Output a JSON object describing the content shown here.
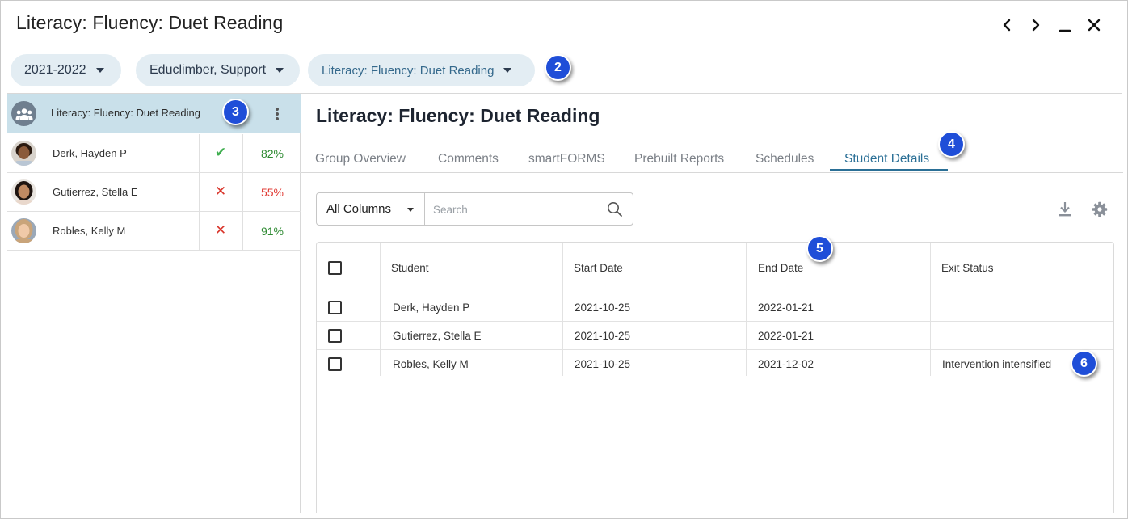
{
  "window": {
    "title": "Literacy: Fluency: Duet Reading"
  },
  "filters": {
    "year": "2021-2022",
    "user": "Educlimber, Support",
    "group": "Literacy: Fluency: Duet Reading"
  },
  "badges": [
    "2",
    "3",
    "4",
    "5",
    "6"
  ],
  "sidebar": {
    "group_name": "Literacy: Fluency: Duet Reading",
    "students": [
      {
        "name": "Derk, Hayden P",
        "status": "check",
        "mark": "✔",
        "percent": "82%"
      },
      {
        "name": "Gutierrez, Stella E",
        "status": "cross",
        "mark": "✕",
        "percent": "55%"
      },
      {
        "name": "Robles, Kelly M",
        "status": "cross",
        "mark": "✕",
        "percent": "91%"
      }
    ]
  },
  "main": {
    "title": "Literacy: Fluency: Duet Reading",
    "tabs": [
      "Group Overview",
      "Comments",
      "smartFORMS",
      "Prebuilt Reports",
      "Schedules",
      "Student Details"
    ],
    "active_tab": "Student Details"
  },
  "toolbar": {
    "column_select": "All Columns",
    "search_placeholder": "Search"
  },
  "table": {
    "columns": [
      "Student",
      "Start Date",
      "End Date",
      "Exit Status"
    ],
    "rows": [
      [
        "Derk, Hayden P",
        "2021-10-25",
        "2022-01-21",
        ""
      ],
      [
        "Gutierrez, Stella E",
        "2021-10-25",
        "2022-01-21",
        ""
      ],
      [
        "Robles, Kelly M",
        "2021-10-25",
        "2021-12-02",
        "Intervention intensified"
      ]
    ]
  },
  "colors": {
    "accent": "#2a6f96",
    "pill_bg": "#e3edf3",
    "selected_row": "#c9e0ea",
    "badge": "#1f4ed8",
    "success": "#3fae4f",
    "danger": "#d9352b"
  }
}
